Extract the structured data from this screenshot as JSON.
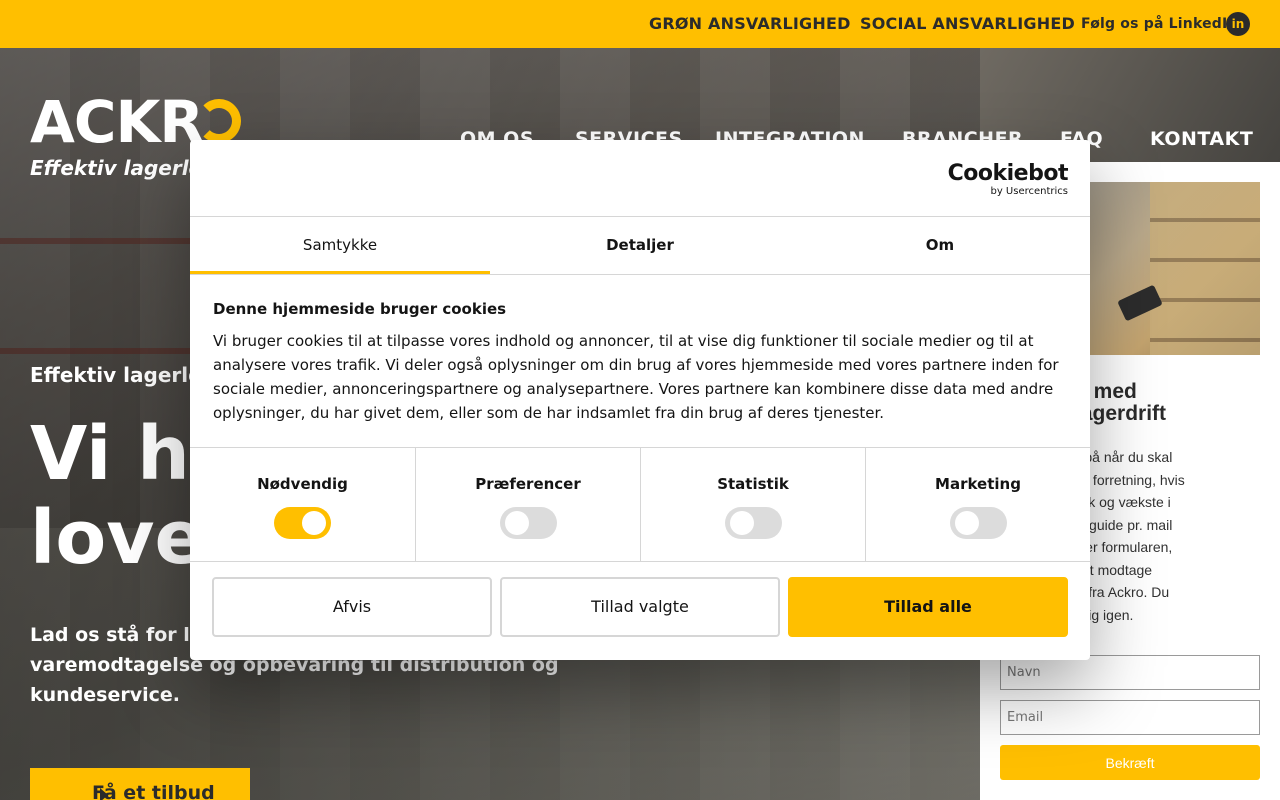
{
  "topbar": {
    "green_link": "GRØN ANSVARLIGHED",
    "social_link": "SOCIAL ANSVARLIGHED",
    "linkedin_link": "Følg os på LinkedIn",
    "linkedin_icon": "in"
  },
  "brand": {
    "logo_text": "ACKR",
    "tagline": "Effektiv lagerlog"
  },
  "nav": {
    "items": [
      "OM OS",
      "SERVICES",
      "INTEGRATION",
      "BRANCHER",
      "FAQ",
      "KONTAKT"
    ]
  },
  "hero": {
    "eyebrow": "Effektiv lagerlo",
    "headline_line1": "Vi ho",
    "headline_line2": "lover",
    "lead": "Lad os stå for lag andet. Vi kan sørge for alt fra varemodtagelse og opbevaring til distribution og kundeservice.",
    "cta_label": "Få et tilbud"
  },
  "sidebar": {
    "title_line1": "r penge med",
    "title_line2": "urced lagerdrift",
    "text_lines": [
      "u have styr på når du skal",
      "optimere din forretning, hvis",
      "ere dynamisk og vækste i",
      "odtag vores guide pr. mail",
      "år du udfylder formularen,",
      "amtykke til at modtage",
      "gsmateriale fra Ackro. Du",
      "id afmelde dig igen."
    ],
    "name_placeholder": "Navn",
    "email_placeholder": "Email",
    "submit_label": "Bekræft"
  },
  "cookie": {
    "brand_main": "Cookiebot",
    "brand_sub": "by Usercentrics",
    "tabs": [
      "Samtykke",
      "Detaljer",
      "Om"
    ],
    "heading": "Denne hjemmeside bruger cookies",
    "body": "Vi bruger cookies til at tilpasse vores indhold og annoncer, til at vise dig funktioner til sociale medier og til at analysere vores trafik. Vi deler også oplysninger om din brug af vores hjemmeside med vores partnere inden for sociale medier, annonceringspartnere og analysepartnere. Vores partnere kan kombinere disse data med andre oplysninger, du har givet dem, eller som de har indsamlet fra din brug af deres tjenester.",
    "categories": [
      {
        "label": "Nødvendig",
        "on": true
      },
      {
        "label": "Præferencer",
        "on": false
      },
      {
        "label": "Statistik",
        "on": false
      },
      {
        "label": "Marketing",
        "on": false
      }
    ],
    "buttons": {
      "reject": "Afvis",
      "allow_selected": "Tillad valgte",
      "allow_all": "Tillad alle"
    }
  },
  "colors": {
    "accent": "#ffbf00",
    "dark": "#2b2b2b"
  }
}
